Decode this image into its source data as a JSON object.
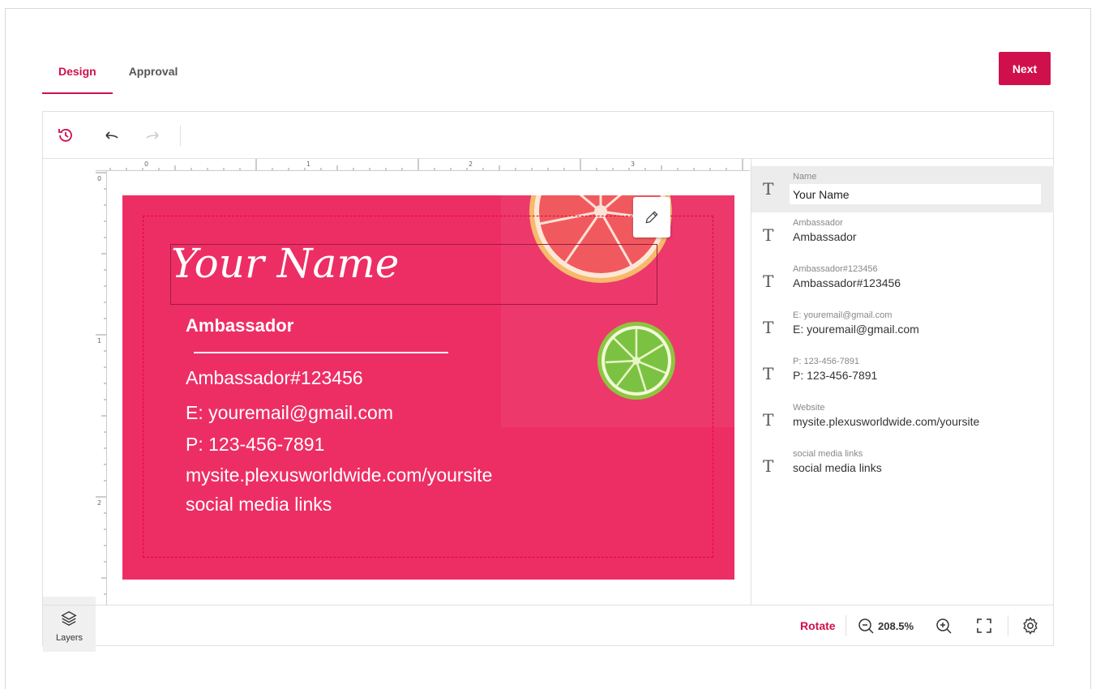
{
  "tabs": [
    {
      "label": "Design",
      "active": true
    },
    {
      "label": "Approval",
      "active": false
    }
  ],
  "next_label": "Next",
  "toolbar": {
    "history_icon": "history-icon",
    "undo_icon": "undo-icon",
    "redo_icon": "redo-icon"
  },
  "ruler": {
    "top_marks": [
      "0",
      "1",
      "2",
      "3"
    ],
    "left_marks": [
      "0",
      "1",
      "2"
    ]
  },
  "card": {
    "name": "Your Name",
    "title": "Ambassador",
    "id": "Ambassador#123456",
    "email": "E: youremail@gmail.com",
    "phone": "P: 123-456-7891",
    "website": "mysite.plexusworldwide.com/yoursite",
    "social": "social media links",
    "background_color": "#ed2e64"
  },
  "layers_label": "Layers",
  "fields": [
    {
      "label": "Name",
      "value": "Your Name",
      "active": true
    },
    {
      "label": "Ambassador",
      "value": "Ambassador"
    },
    {
      "label": "Ambassador#123456",
      "value": "Ambassador#123456"
    },
    {
      "label": "E: youremail@gmail.com",
      "value": "E: youremail@gmail.com"
    },
    {
      "label": "P: 123-456-7891",
      "value": "P: 123-456-7891"
    },
    {
      "label": "Website",
      "value": "mysite.plexusworldwide.com/yoursite"
    },
    {
      "label": "social media links",
      "value": "social media links"
    }
  ],
  "bottom": {
    "rotate_label": "Rotate",
    "zoom": "208.5%"
  },
  "accent_color": "#d0104c"
}
